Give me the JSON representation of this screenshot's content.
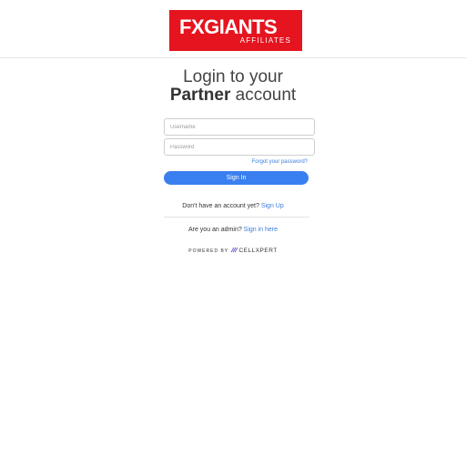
{
  "header": {
    "logo_main": "FXGIANTS",
    "logo_sub": "AFFILIATES"
  },
  "title": {
    "line1": "Login to your",
    "line2_bold": "Partner",
    "line2_rest": " account"
  },
  "form": {
    "username_placeholder": "Username",
    "password_placeholder": "Password",
    "forgot_link": "Forgot your password?",
    "signin_button": "Sign In"
  },
  "signup": {
    "text": "Don't have an account yet? ",
    "link": "Sign Up"
  },
  "admin": {
    "text": "Are you an admin? ",
    "link": "Sign in here"
  },
  "footer": {
    "powered_by": "POWERED BY ",
    "brand": "CELLXPERT"
  },
  "colors": {
    "logo_red": "#e5141e",
    "primary_blue": "#3a7ff0",
    "link_blue": "#3b7ddd"
  },
  "icons": {
    "footer_brand": "cellxpert-icon"
  }
}
